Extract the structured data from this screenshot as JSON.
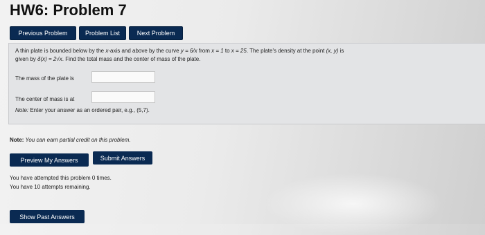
{
  "page": {
    "title": "HW6: Problem 7"
  },
  "nav": {
    "previous": "Previous Problem",
    "list": "Problem List",
    "next": "Next Problem"
  },
  "problem": {
    "line1_a": "A thin plate is bounded below by the ",
    "line1_b": "x",
    "line1_c": "-axis and above by the curve ",
    "line1_d": "y = 6/x",
    "line1_e": " from ",
    "line1_f": "x = 1",
    "line1_g": " to ",
    "line1_h": "x = 25",
    "line1_i": ". The plate's density at the point ",
    "line1_j": "(x, y)",
    "line1_k": " is",
    "line2_a": "given by ",
    "line2_b": "δ(x) = 2√x",
    "line2_c": ". Find the total mass and the center of mass of the plate.",
    "mass_label": "The mass of the plate is",
    "mass_value": "",
    "center_label": "The center of mass is at",
    "center_value": "",
    "note_prefix": "Note:",
    "note_text": " Enter your answer as an ordered pair, e.g., (5,7)."
  },
  "partial": {
    "prefix": "Note:",
    "text": " You can earn partial credit on this problem."
  },
  "actions": {
    "preview": "Preview My Answers",
    "submit": "Submit Answers",
    "show_past": "Show Past Answers"
  },
  "attempts": {
    "line1": "You have attempted this problem 0 times.",
    "line2": "You have 10 attempts remaining."
  }
}
